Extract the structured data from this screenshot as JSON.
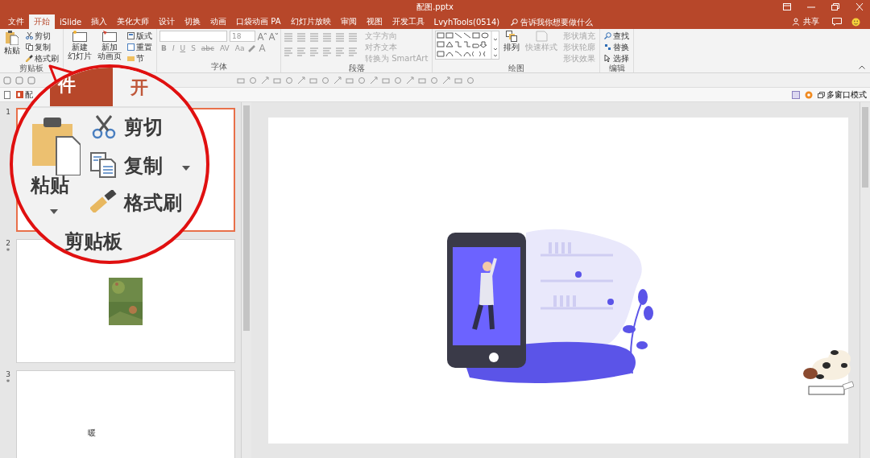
{
  "window": {
    "title": "配图.pptx"
  },
  "tabs": [
    {
      "label": "文件",
      "selected": false
    },
    {
      "label": "开始",
      "selected": true
    },
    {
      "label": "iSlide",
      "selected": false
    },
    {
      "label": "插入",
      "selected": false
    },
    {
      "label": "美化大师",
      "selected": false
    },
    {
      "label": "设计",
      "selected": false
    },
    {
      "label": "切换",
      "selected": false
    },
    {
      "label": "动画",
      "selected": false
    },
    {
      "label": "口袋动画 PA",
      "selected": false
    },
    {
      "label": "幻灯片放映",
      "selected": false
    },
    {
      "label": "审阅",
      "selected": false
    },
    {
      "label": "视图",
      "selected": false
    },
    {
      "label": "开发工具",
      "selected": false
    },
    {
      "label": "LvyhTools(0514)",
      "selected": false
    }
  ],
  "tell_me": {
    "placeholder": "告诉我你想要做什么"
  },
  "share": {
    "label": "共享"
  },
  "clipboard": {
    "label": "剪贴板",
    "paste": "粘贴",
    "cut": "剪切",
    "copy": "复制",
    "format_painter": "格式刷"
  },
  "slides_group": {
    "new_slide": [
      "新建",
      "幻灯片"
    ],
    "new_anim": [
      "新加",
      "动画页"
    ],
    "layout": "版式",
    "reset": "重置",
    "section": "节"
  },
  "font": {
    "label": "字体",
    "size": "18",
    "format_buttons": [
      "B",
      "I",
      "U",
      "S",
      "abc",
      "AV",
      "Aa"
    ]
  },
  "paragraph": {
    "label": "段落",
    "disabled": true,
    "text_direction": "文字方向",
    "align_text": "对齐文本",
    "smartart": "转换为 SmartArt"
  },
  "drawing": {
    "label": "绘图",
    "arrange": "排列",
    "quick_styles": "快速样式",
    "shape_fill": "形状填充",
    "shape_outline": "形状轮廓",
    "shape_effects": "形状效果",
    "disabled": true
  },
  "editing": {
    "label": "编辑",
    "find": "查找",
    "replace": "替换",
    "select": "选择"
  },
  "doc_bar": {
    "tab": "配",
    "multi_window": "多窗口模式"
  },
  "thumbnails": [
    {
      "number": "1",
      "selected": true,
      "kind": "blank"
    },
    {
      "number": "2",
      "mark": "*",
      "selected": false,
      "kind": "picture"
    },
    {
      "number": "3",
      "mark": "*",
      "selected": false,
      "kind": "text",
      "text": "暖"
    }
  ],
  "magnifier": {
    "file_tab": "件",
    "home_tab": "开",
    "paste": "粘贴",
    "cut": "剪切",
    "copy": "复制",
    "format_painter": "格式刷",
    "group_label": "剪贴板"
  }
}
